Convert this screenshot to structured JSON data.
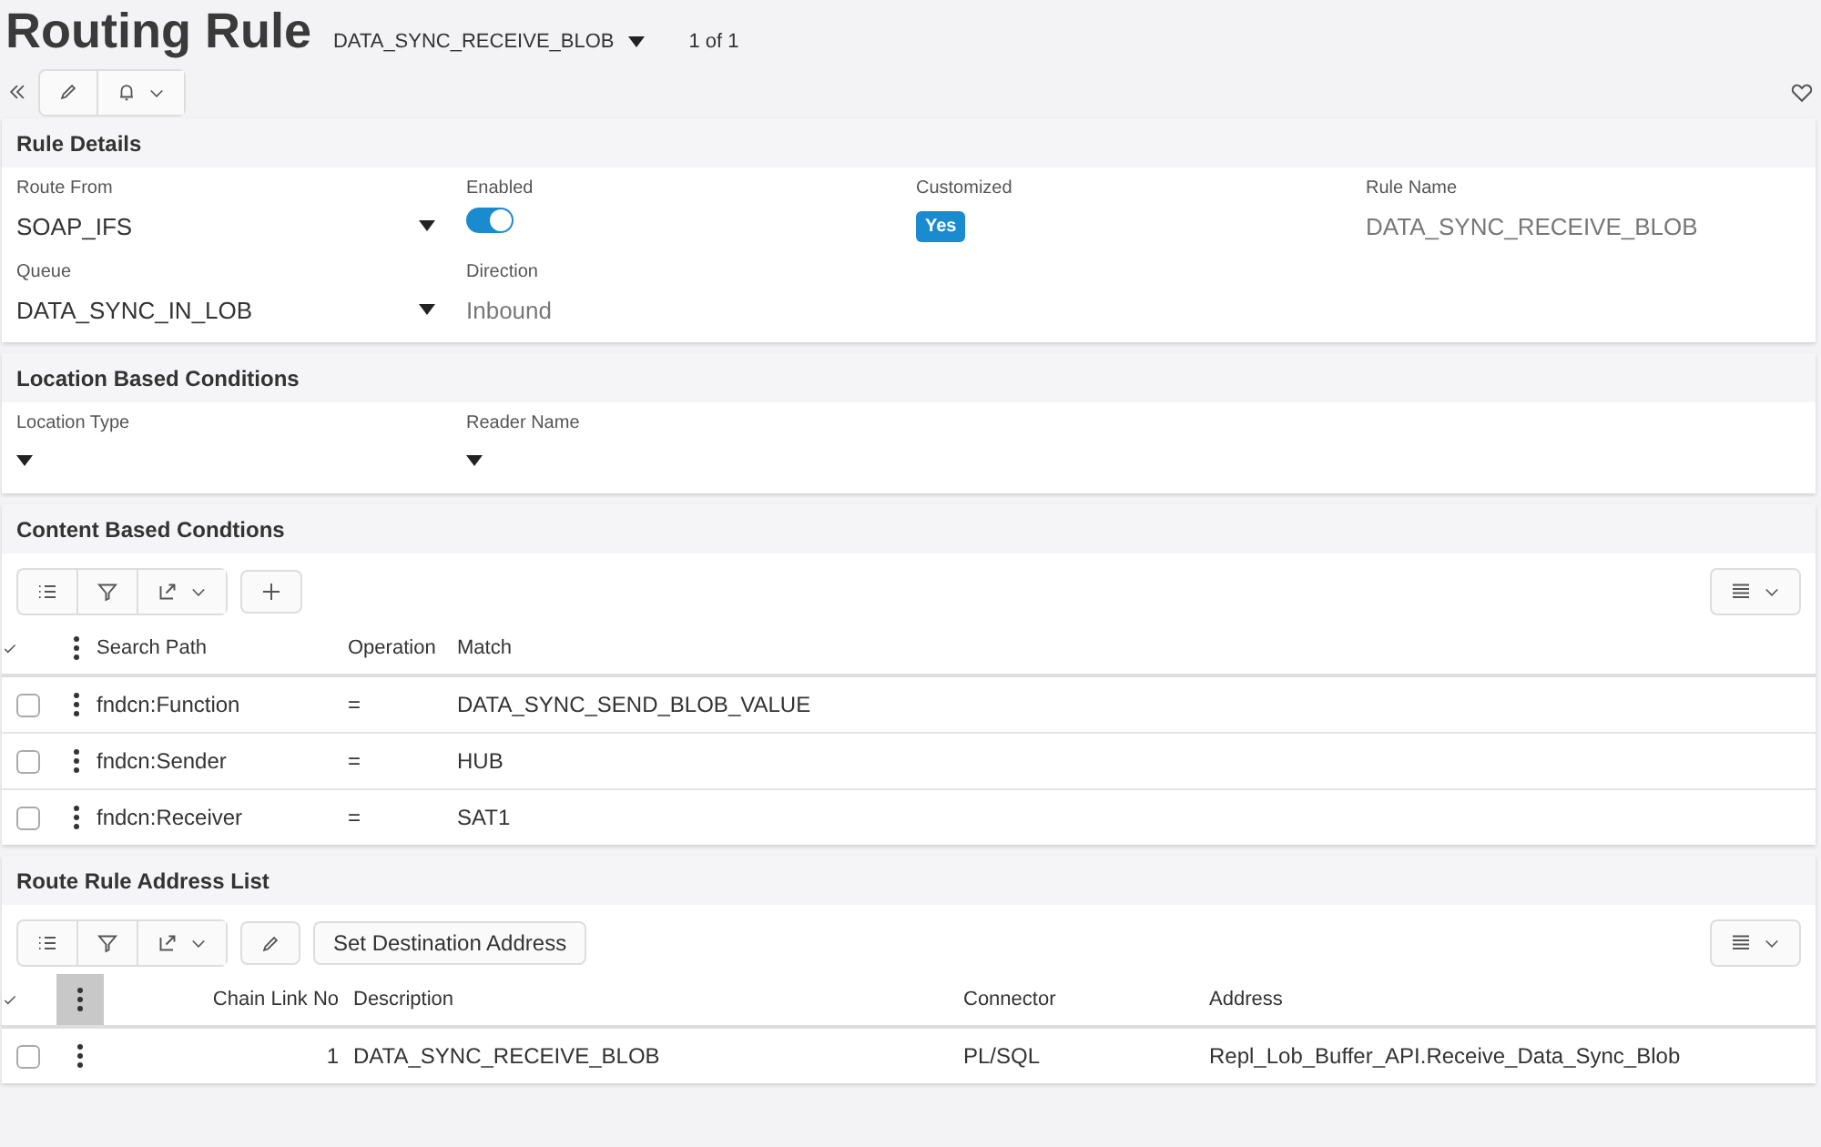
{
  "header": {
    "title": "Routing Rule",
    "record": "DATA_SYNC_RECEIVE_BLOB",
    "count": "1 of 1"
  },
  "rule_details": {
    "title": "Rule Details",
    "fields": [
      {
        "kind": "select",
        "label": "Route From",
        "value": "SOAP_IFS"
      },
      {
        "kind": "toggle",
        "label": "Enabled",
        "on": true
      },
      {
        "kind": "badge",
        "label": "Customized",
        "value": "Yes"
      },
      {
        "kind": "text",
        "label": "Rule Name",
        "value": "DATA_SYNC_RECEIVE_BLOB"
      },
      {
        "kind": "select",
        "label": "Queue",
        "value": "DATA_SYNC_IN_LOB"
      },
      {
        "kind": "text",
        "label": "Direction",
        "value": "Inbound"
      }
    ]
  },
  "location_conditions": {
    "title": "Location Based Conditions",
    "fields": [
      {
        "kind": "select",
        "label": "Location Type"
      },
      {
        "kind": "select",
        "label": "Reader Name"
      }
    ]
  },
  "content_conditions": {
    "title": "Content Based Condtions",
    "columns": [
      "Search Path",
      "Operation",
      "Match"
    ],
    "rows": [
      {
        "checked": false,
        "cells": [
          "fndcn:Function",
          "=",
          "DATA_SYNC_SEND_BLOB_VALUE"
        ]
      },
      {
        "checked": false,
        "cells": [
          "fndcn:Sender",
          "=",
          "HUB"
        ]
      },
      {
        "checked": false,
        "cells": [
          "fndcn:Receiver",
          "=",
          "SAT1"
        ]
      }
    ]
  },
  "address_list": {
    "title": "Route Rule Address List",
    "action": "Set Destination Address",
    "columns": [
      "Chain Link No",
      "Description",
      "Connector",
      "Address"
    ],
    "rows": [
      {
        "checked": false,
        "cells": [
          "1",
          "DATA_SYNC_RECEIVE_BLOB",
          "PL/SQL",
          "Repl_Lob_Buffer_API.Receive_Data_Sync_Blob"
        ]
      }
    ]
  }
}
